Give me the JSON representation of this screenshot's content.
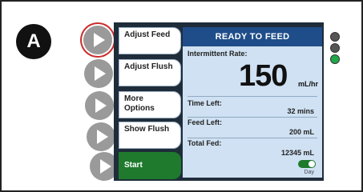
{
  "figure_label": "A",
  "menu": {
    "items": [
      {
        "label": "Adjust Feed"
      },
      {
        "label": "Adjust Flush"
      },
      {
        "label": "More Options"
      },
      {
        "label": "Show Flush"
      },
      {
        "label": "Start"
      }
    ]
  },
  "status": {
    "title": "READY TO FEED",
    "rate_label": "Intermittent Rate:",
    "rate_value": "150",
    "rate_unit": "mL/hr",
    "rows": [
      {
        "label": "Time Left:",
        "value": "32 mins"
      },
      {
        "label": "Feed Left:",
        "value": "200 mL"
      },
      {
        "label": "Total Fed:",
        "value": "12345 mL"
      }
    ],
    "toggle_label": "Day"
  },
  "colors": {
    "header": "#1f4d89",
    "panel": "#cfe1f2",
    "start": "#1f7a2e",
    "selected_ring": "#cc2b2b",
    "led_on": "#1fa84a"
  }
}
